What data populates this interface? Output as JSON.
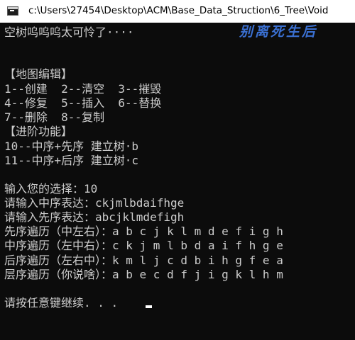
{
  "window": {
    "title": "c:\\Users\\27454\\Desktop\\ACM\\Base_Data_Struction\\6_Tree\\Void"
  },
  "overlay_text": "别离死生后",
  "console": {
    "lines": [
      "空树呜呜呜太可怜了····",
      "【地图编辑】",
      "1--创建  2--清空  3--摧毁",
      "4--修复  5--插入  6--替换",
      "7--删除  8--复制",
      "【进阶功能】",
      "10--中序+先序 建立树·b",
      "11--中序+后序 建立树·c",
      "输入您的选择：10",
      "请输入中序表达：ckjmlbdaifhge",
      "请输入先序表达：abcjklmdefigh",
      "先序遍历（中左右）：a b c j k l m d e f i g h",
      "中序遍历（左中右）：c k j m l b d a i f h g e",
      "后序遍历（左右中）：k m l j c d b i h g f e a",
      "层序遍历（你说啥）：a b e c d f j i g k l h m",
      "请按任意键继续. . ."
    ]
  }
}
